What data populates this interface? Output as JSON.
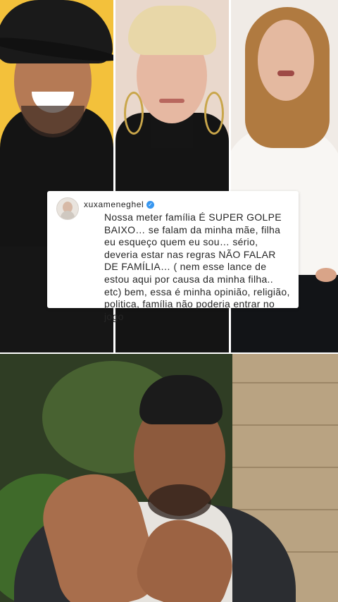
{
  "comment_card": {
    "username": "xuxameneghel",
    "verified_icon": "verified-badge-icon",
    "text": "Nossa meter família  É SUPER GOLPE BAIXO… se falam da minha mãe, filha eu esqueço quem eu sou… sério, deveria estar nas regras NÃO FALAR DE FAMÍLIA… ( nem esse lance de estou aqui por causa da minha filha.. etc) bem, essa é minha opinião, religião, politica, família não poderia entrar no jogo",
    "accent_color": "#3897f0"
  },
  "photos": [
    {
      "name": "man-in-black-hat",
      "background": "#f3c13b"
    },
    {
      "name": "woman-short-blonde-hair",
      "background": "#e9d8cc"
    },
    {
      "name": "woman-long-hair-white-top",
      "background": "#f0ebe6"
    },
    {
      "name": "man-reacting-outdoors",
      "background": "#3a4a2e"
    }
  ]
}
